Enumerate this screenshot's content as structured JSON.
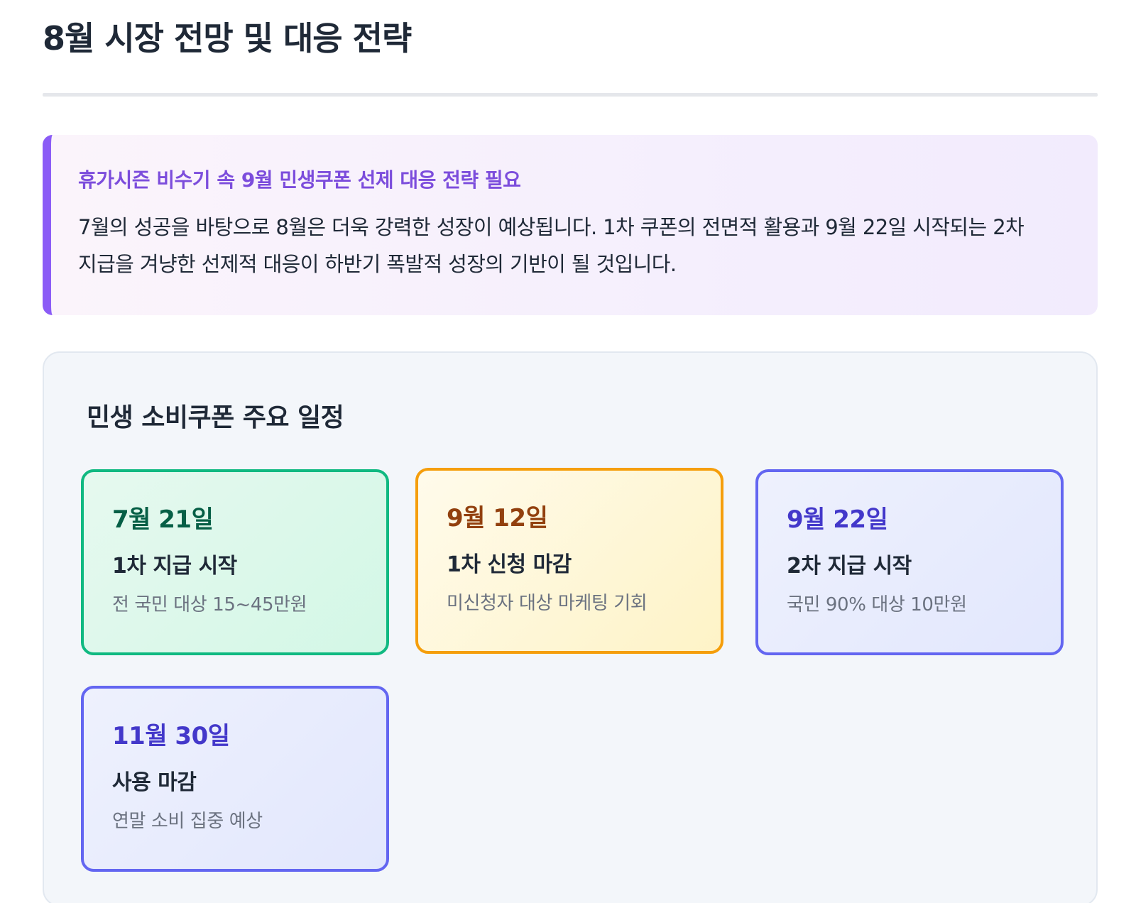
{
  "page": {
    "title": "8월 시장 전망 및 대응 전략"
  },
  "highlight": {
    "heading": "휴가시즌 비수기 속 9월 민생쿠폰 선제 대응 전략 필요",
    "body": "7월의 성공을 바탕으로 8월은 더욱 강력한 성장이 예상됩니다. 1차 쿠폰의 전면적 활용과 9월 22일 시작되는 2차 지급을 겨냥한 선제적 대응이 하반기 폭발적 성장의 기반이 될 것입니다.",
    "accent_color": "#8b5cf6"
  },
  "schedule": {
    "title": "민생 소비쿠폰 주요 일정",
    "cards": [
      {
        "date": "7월 21일",
        "label": "1차 지급 시작",
        "desc": "전 국민 대상 15~45만원",
        "color": "#10b981"
      },
      {
        "date": "9월 12일",
        "label": "1차 신청 마감",
        "desc": "미신청자 대상 마케팅 기회",
        "color": "#f59e0b"
      },
      {
        "date": "9월 22일",
        "label": "2차 지급 시작",
        "desc": "국민 90% 대상 10만원",
        "color": "#6366f1"
      },
      {
        "date": "11월 30일",
        "label": "사용 마감",
        "desc": "연말 소비 집중 예상",
        "color": "#6366f1"
      }
    ]
  }
}
